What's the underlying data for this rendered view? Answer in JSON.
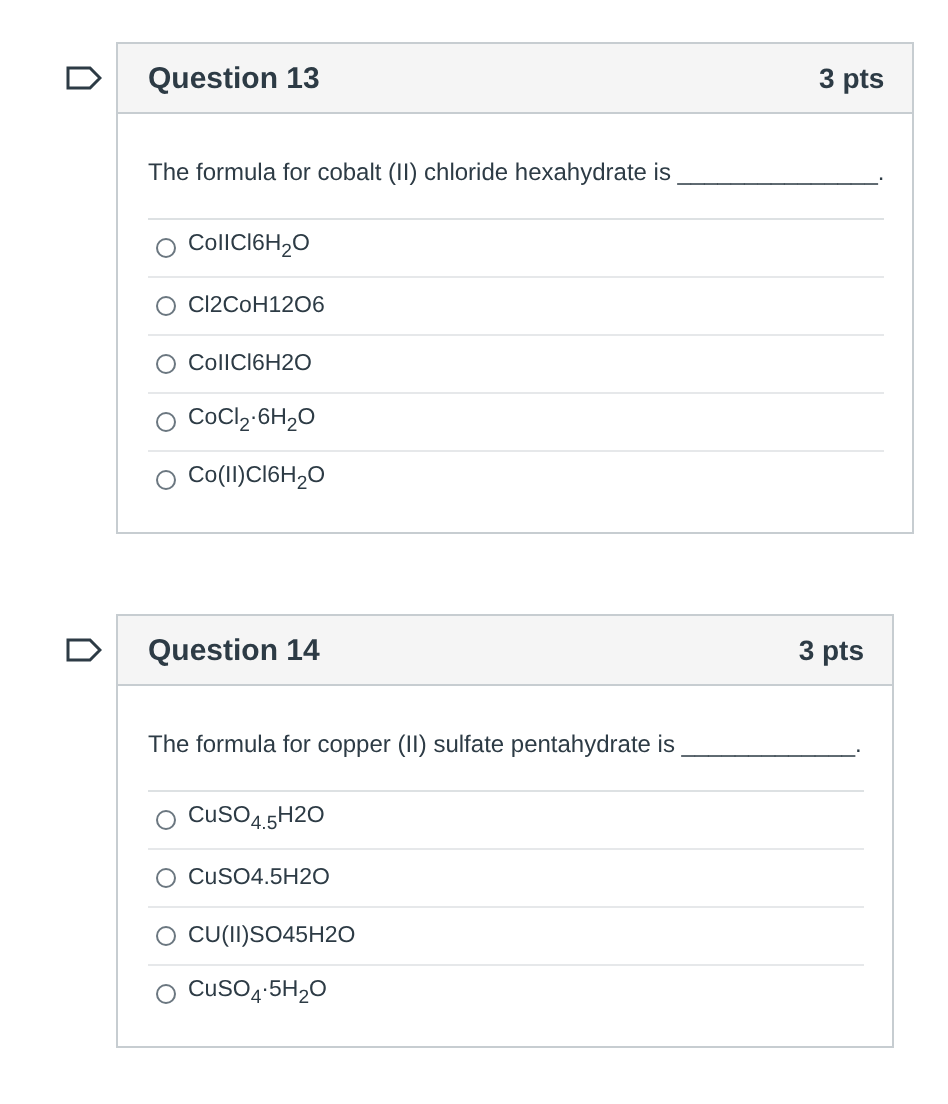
{
  "questions": [
    {
      "title": "Question 13",
      "points": "3 pts",
      "prompt": "The formula for cobalt (II) chloride hexahydrate is _______________.",
      "options": [
        {
          "label": "CoIICl6H$_{2}$O",
          "selected": false
        },
        {
          "label": "Cl2CoH12O6",
          "selected": false
        },
        {
          "label": "CoIICl6H2O",
          "selected": false
        },
        {
          "label": "CoCl$_{2}$·6H$_{2}$O",
          "selected": false
        },
        {
          "label": "Co(II)Cl6H$_{2}$O",
          "selected": false
        }
      ]
    },
    {
      "title": "Question 14",
      "points": "3 pts",
      "prompt": "The formula for copper (II) sulfate pentahydrate is _____________.",
      "options": [
        {
          "label": "CuSO$_{4.5}$H2O",
          "selected": false
        },
        {
          "label": "CuSO4.5H2O",
          "selected": false
        },
        {
          "label": "CU(II)SO45H2O",
          "selected": false
        },
        {
          "label": "CuSO$_{4}$·5H$_{2}$O",
          "selected": false
        }
      ]
    }
  ]
}
